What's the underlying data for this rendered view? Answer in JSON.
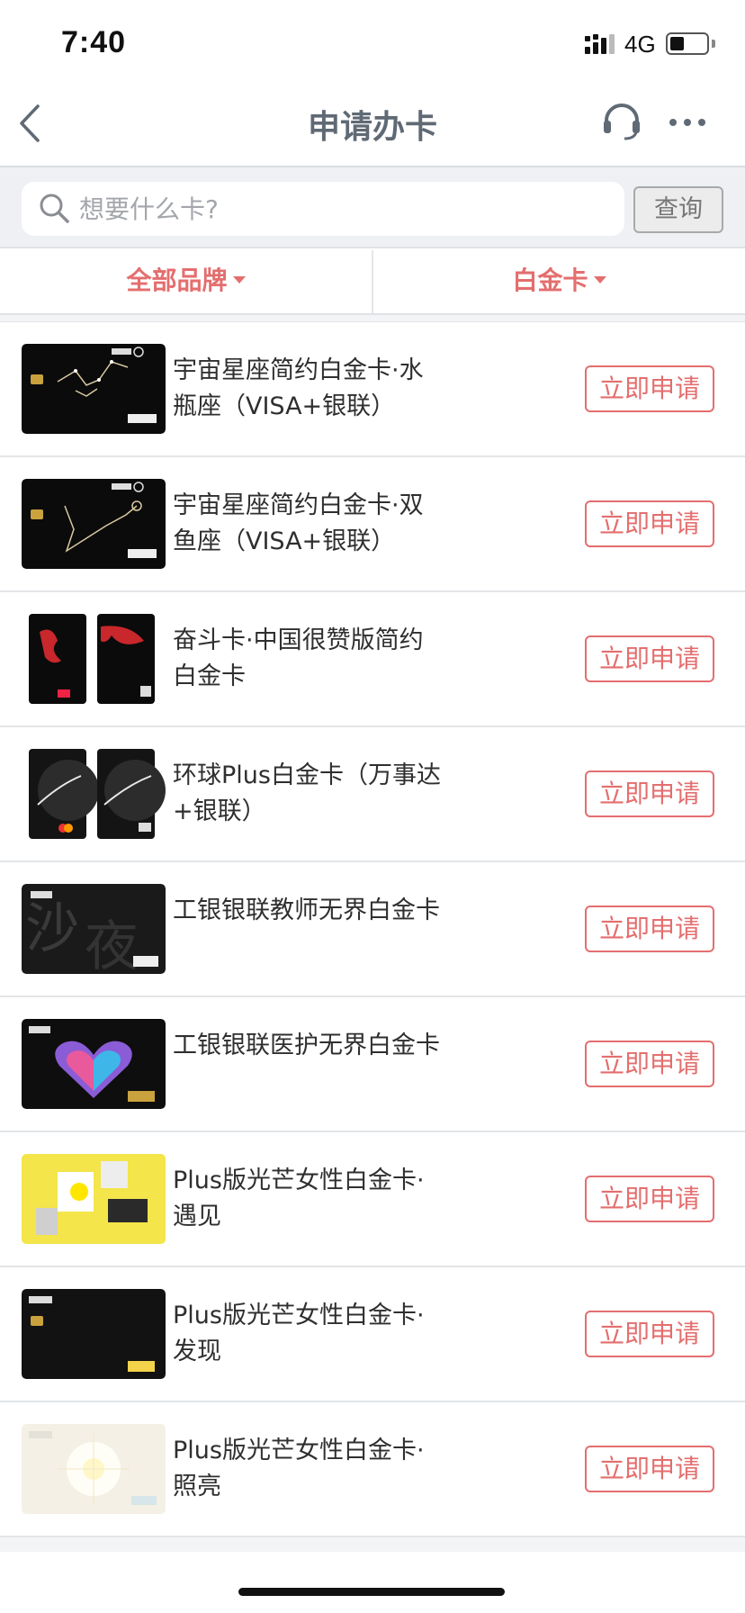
{
  "status": {
    "time": "7:40",
    "network": "4G"
  },
  "nav": {
    "title": "申请办卡",
    "back_icon": "chevron-left-icon",
    "service_icon": "headset-icon",
    "more_icon": "ellipsis-icon"
  },
  "search": {
    "placeholder": "想要什么卡?",
    "value": "",
    "query_label": "查询"
  },
  "filters": {
    "brand": "全部品牌",
    "level": "白金卡"
  },
  "apply_label": "立即申请",
  "cards": [
    {
      "title": "宇宙星座简约白金卡·水瓶座（VISA+银联）"
    },
    {
      "title": "宇宙星座简约白金卡·双鱼座（VISA+银联）"
    },
    {
      "title": "奋斗卡·中国很赞版简约白金卡"
    },
    {
      "title": "环球Plus白金卡（万事达+银联）"
    },
    {
      "title": "工银银联教师无界白金卡"
    },
    {
      "title": "工银银联医护无界白金卡"
    },
    {
      "title": "Plus版光芒女性白金卡·遇见"
    },
    {
      "title": "Plus版光芒女性白金卡·发现"
    },
    {
      "title": "Plus版光芒女性白金卡·照亮"
    }
  ],
  "colors": {
    "accent": "#e46e6e",
    "title_gray": "#5f6a75",
    "search_bg": "#eef0f3"
  }
}
